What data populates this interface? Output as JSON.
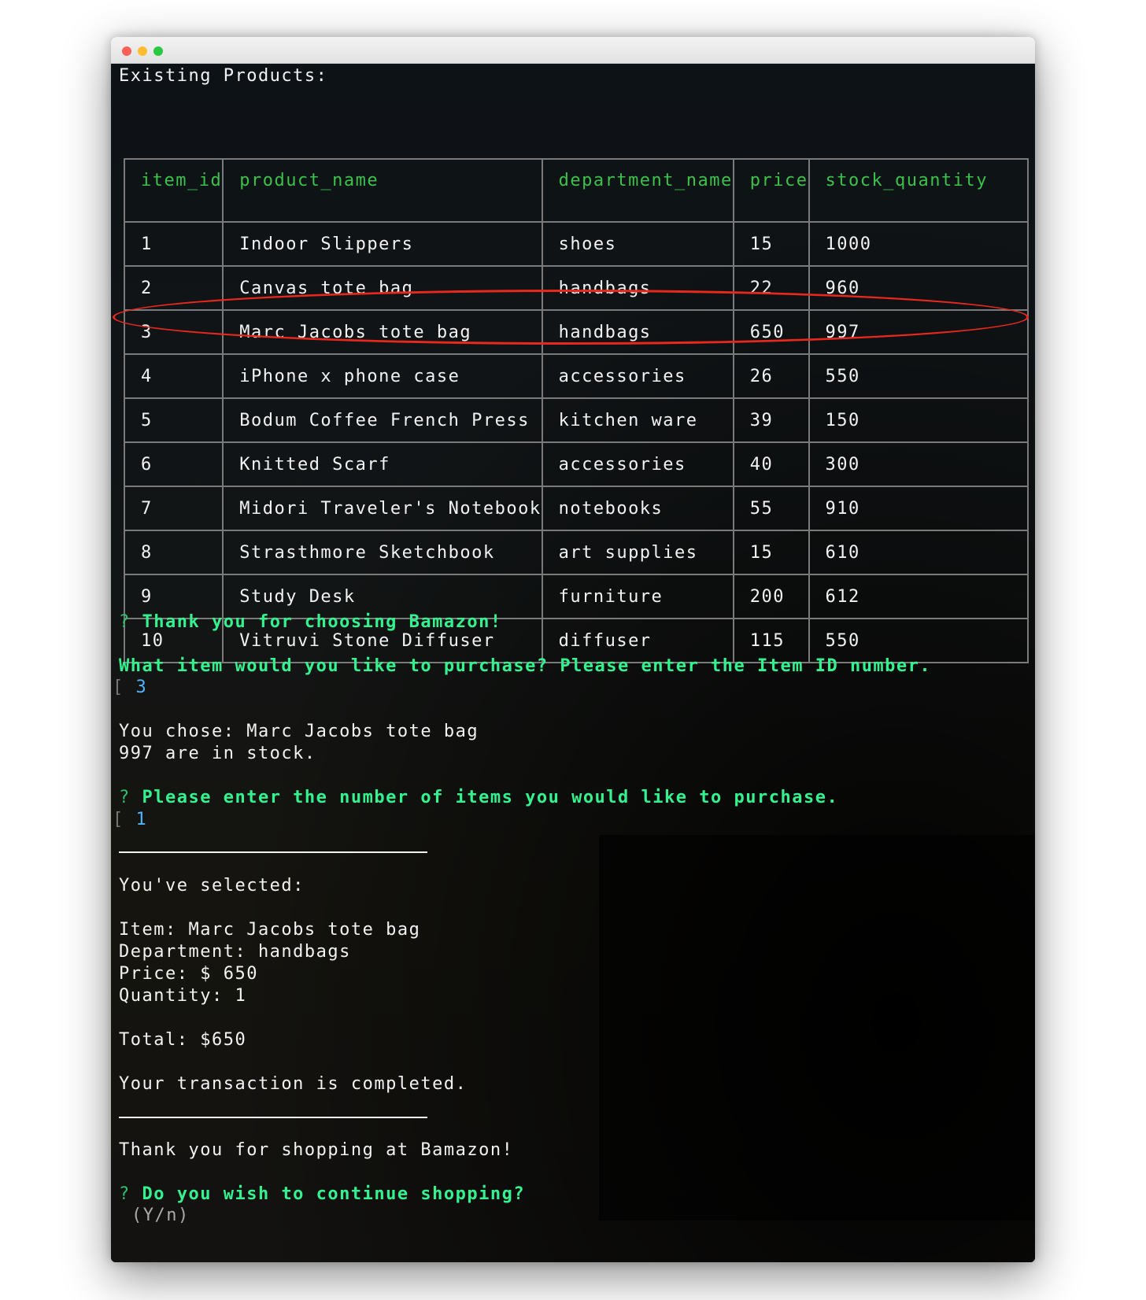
{
  "window": {
    "controls": [
      "close",
      "minimize",
      "zoom"
    ]
  },
  "header": "Existing Products:",
  "table": {
    "columns": [
      "item_id",
      "product_name",
      "department_name",
      "price",
      "stock_quantity"
    ],
    "rows": [
      [
        "1",
        "Indoor Slippers",
        "shoes",
        "15",
        "1000"
      ],
      [
        "2",
        "Canvas tote bag",
        "handbags",
        "22",
        "960"
      ],
      [
        "3",
        "Marc Jacobs tote bag",
        "handbags",
        "650",
        "997"
      ],
      [
        "4",
        "iPhone x phone case",
        "accessories",
        "26",
        "550"
      ],
      [
        "5",
        "Bodum Coffee French Press",
        "kitchen ware",
        "39",
        "150"
      ],
      [
        "6",
        "Knitted Scarf",
        "accessories",
        "40",
        "300"
      ],
      [
        "7",
        "Midori Traveler's Notebook",
        "notebooks",
        "55",
        "910"
      ],
      [
        "8",
        "Strasthmore Sketchbook",
        "art supplies",
        "15",
        "610"
      ],
      [
        "9",
        "Study Desk",
        "furniture",
        "200",
        "612"
      ],
      [
        "10",
        "Vitruvi Stone Diffuser",
        "diffuser",
        "115",
        "550"
      ]
    ],
    "highlighted_row_index": 2,
    "highlight_color": "#e8281c"
  },
  "prompt1": {
    "mark": "?",
    "text": "Thank you for choosing Bamazon!"
  },
  "prompt1b": "What item would you like to purchase? Please enter the Item ID number.",
  "answer1": {
    "bracket": "[",
    "value": "3"
  },
  "chose": "You chose: Marc Jacobs tote bag",
  "stock": "997 are in stock.",
  "prompt2": {
    "mark": "?",
    "text": "Please enter the number of items you would like to purchase."
  },
  "answer2": {
    "bracket": "[",
    "value": "1"
  },
  "summary": {
    "heading": "You've selected:",
    "item": "Item: Marc Jacobs tote bag",
    "department": "Department: handbags",
    "price": "Price: $ 650",
    "quantity": "Quantity: 1",
    "total": "Total: $650",
    "completed": "Your transaction is completed."
  },
  "thanks": "Thank you for shopping at Bamazon!",
  "prompt3": {
    "mark": "?",
    "text": "Do you wish to continue shopping?"
  },
  "prompt3_hint": "(Y/n)",
  "colors": {
    "prompt": "#33f28f",
    "header": "#3ac24a",
    "answer": "#4fb3ff",
    "text": "#f2f2f2"
  }
}
